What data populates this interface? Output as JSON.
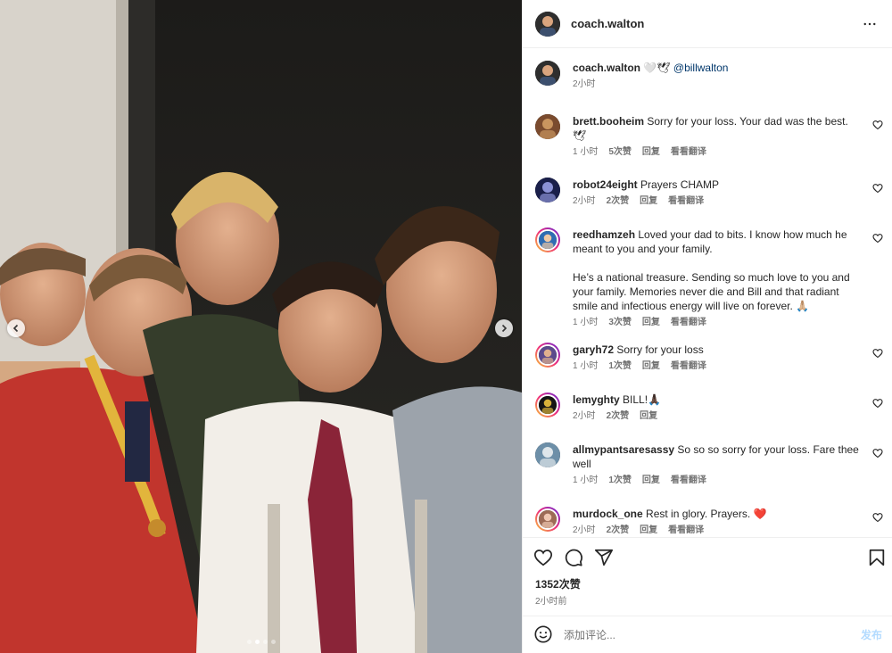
{
  "post": {
    "author": "coach.walton",
    "likes": "1352次赞",
    "time": "2小时前"
  },
  "caption": {
    "user": "coach.walton",
    "emoji": "🤍🕊",
    "mention": "@billwalton",
    "time": "2小时"
  },
  "labels": {
    "reply": "回复",
    "translate": "看看翻译"
  },
  "comments": [
    {
      "user": "brett.booheim",
      "text": "Sorry for your loss. Your dad was the best. 🕊",
      "time": "1 小时",
      "likes": "5次赞",
      "translate": true
    },
    {
      "user": "robot24eight",
      "text": "Prayers CHAMP",
      "time": "2小时",
      "likes": "2次赞",
      "translate": true
    },
    {
      "user": "reedhamzeh",
      "text": "Loved your dad to bits. I know how much he meant to you and your family.\n\nHe’s a national treasure. Sending so much love to you and your family. Memories never die and Bill and that radiant smile and infectious energy will live on forever. 🙏🏼",
      "time": "1 小时",
      "likes": "3次赞",
      "translate": true
    },
    {
      "user": "garyh72",
      "text": "Sorry for your loss",
      "time": "1 小时",
      "likes": "1次赞",
      "translate": true
    },
    {
      "user": "lemyghty",
      "text": "BILL!🙏🏿",
      "time": "2小时",
      "likes": "2次赞",
      "translate": false
    },
    {
      "user": "allmypantsaresassy",
      "text": "So so so sorry for your loss. Fare thee well",
      "time": "1 小时",
      "likes": "1次赞",
      "translate": true
    },
    {
      "user": "murdock_one",
      "text": "Rest in glory. Prayers. ❤️",
      "time": "2小时",
      "likes": "2次赞",
      "translate": true
    }
  ],
  "composer": {
    "placeholder": "添加评论...",
    "post_label": "发布"
  },
  "colors": {
    "link": "#00376b",
    "muted": "#737373",
    "post_disabled": "#b3dbff"
  },
  "carousel": {
    "dots": 4,
    "active_index": 1
  }
}
